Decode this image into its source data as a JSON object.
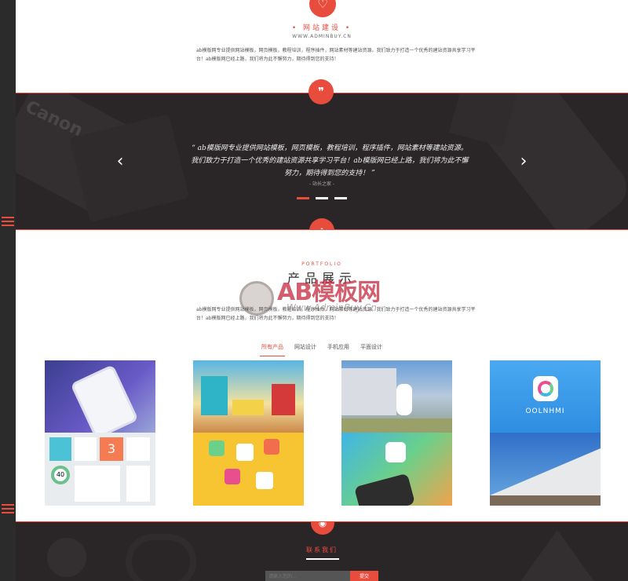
{
  "about": {
    "title": "• 网站建设 •",
    "url": "WWW.ADMINBUY.CN",
    "desc": "ab模版网专业提供网站模板，网页模板，教程培训，程序插件，网站素材等建站资源。我们致力于打造一个优秀的建站资源共享学习平台！ab模版网已经上路，我们将为此不懈努力，期待得到您的支持！"
  },
  "slider": {
    "quote": "“ ab模版网专业提供网站模板，网页模板，教程培训，程序插件，网站素材等建站资源。我们致力于打造一个优秀的建站资源共享学习平台！ab模版网已经上路，我们将为此不懈努力，期待得到您的支持！ ”",
    "author": "- 站长之家 -",
    "bg_text": "Canon"
  },
  "products": {
    "subtitle": "PORTFOLIO",
    "title": "产品展示",
    "desc": "ab模版网专业提供网站模板，网页模板，教程培训，程序插件，网站素材等建站资源。我们致力于打造一个优秀的建站资源共享学习平台！ab模版网已经上路，我们将为此不懈努力，期待得到您的支持！",
    "watermark_big": "AB模板网",
    "watermark_small": "Www.AdminBuy.Cn",
    "tabs": [
      "所有产品",
      "网站设计",
      "手机应用",
      "平面设计"
    ],
    "card4_label": "OOLNHMI"
  },
  "contact": {
    "title": "联系我们",
    "placeholder": "请输入您的...",
    "button": "提交"
  },
  "colors": {
    "accent": "#e84c3d",
    "dark": "#2a2627"
  }
}
